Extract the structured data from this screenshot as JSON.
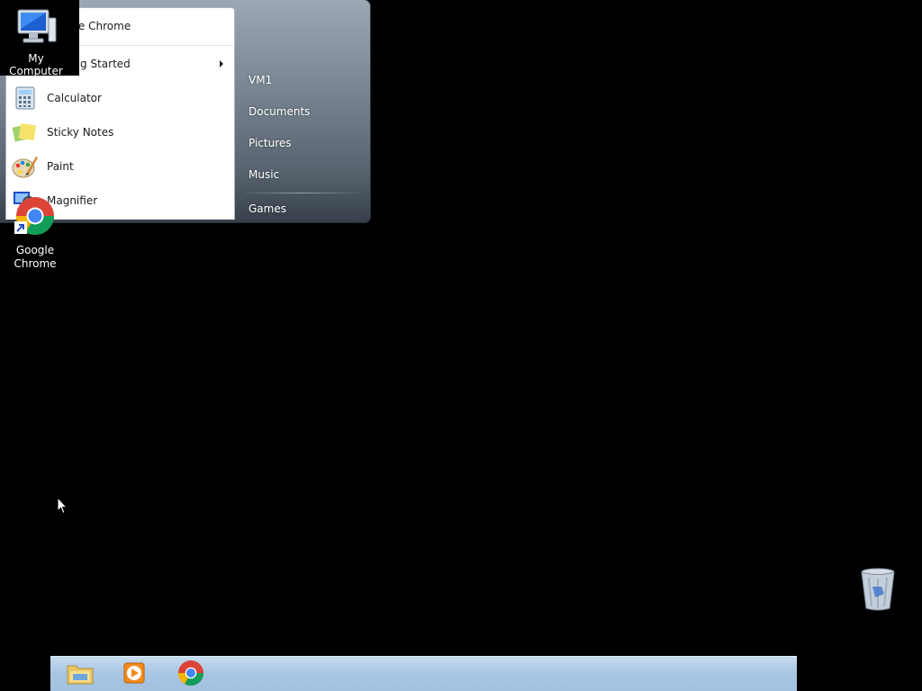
{
  "start_menu": {
    "programs": [
      {
        "label": "Google Chrome",
        "icon": "chrome-icon",
        "submenu": false
      },
      {
        "label": "Getting Started",
        "icon": "getting-started-icon",
        "submenu": true
      },
      {
        "label": "Calculator",
        "icon": "calculator-icon",
        "submenu": false
      },
      {
        "label": "Sticky Notes",
        "icon": "sticky-notes-icon",
        "submenu": false
      },
      {
        "label": "Paint",
        "icon": "paint-icon",
        "submenu": false
      },
      {
        "label": "Magnifier",
        "icon": "magnifier-icon",
        "submenu": false
      }
    ],
    "places": [
      {
        "label": "VM1"
      },
      {
        "label": "Documents"
      },
      {
        "label": "Pictures"
      },
      {
        "label": "Music"
      },
      {
        "label": "Games"
      }
    ]
  },
  "desktop": {
    "my_computer": {
      "label": "My Computer",
      "icon": "computer-icon"
    },
    "chrome": {
      "label": "Google Chrome",
      "icon": "chrome-shortcut-icon"
    },
    "recycle_bin": {
      "icon": "recycle-bin-icon"
    }
  },
  "taskbar": {
    "buttons": [
      {
        "icon": "explorer-folder-icon"
      },
      {
        "icon": "media-player-icon"
      },
      {
        "icon": "chrome-icon"
      }
    ]
  },
  "colors": {
    "desktop": "#000000",
    "taskbar": "#a9c6e4",
    "menu_dark": "#37404a"
  }
}
